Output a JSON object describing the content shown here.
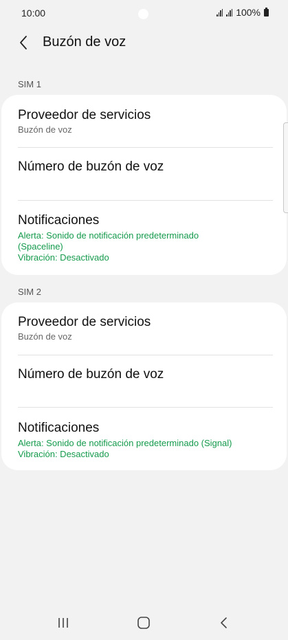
{
  "status_bar": {
    "time": "10:00",
    "battery": "100%",
    "icons": [
      "signal-icon",
      "signal-icon",
      "battery-icon"
    ]
  },
  "header": {
    "back_icon": "chevron-left-icon",
    "title": "Buzón de voz"
  },
  "sim1": {
    "label": "SIM 1",
    "provider_title": "Proveedor de servicios",
    "provider_value": "Buzón de voz",
    "number_title": "Número de buzón de voz",
    "notifications_title": "Notificaciones",
    "notifications_alert_line1": "Alerta: Sonido de notificación predeterminado",
    "notifications_alert_line2": "(Spaceline)",
    "notifications_vibration": "Vibración: Desactivado"
  },
  "sim2": {
    "label": "SIM 2",
    "provider_title": "Proveedor de servicios",
    "provider_value": "Buzón de voz",
    "number_title": "Número de buzón de voz",
    "notifications_title": "Notificaciones",
    "notifications_alert": "Alerta: Sonido de notificación predeterminado (Signal)",
    "notifications_vibration": "Vibración: Desactivado"
  },
  "nav_bar": {
    "icons": [
      "recent-apps-icon",
      "home-icon",
      "back-icon"
    ]
  },
  "colors": {
    "background": "#f2f2f2",
    "card": "#ffffff",
    "accent_green": "#149a4c"
  }
}
